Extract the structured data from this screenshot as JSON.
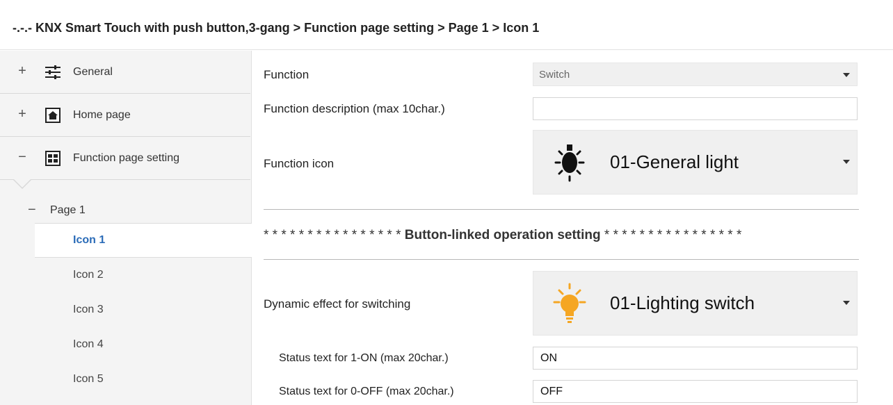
{
  "breadcrumb": "-.-.- KNX Smart Touch with push button,3-gang > Function page setting > Page 1 > Icon 1",
  "sidebar": {
    "items": [
      {
        "label": "General",
        "expander": "+",
        "icon": "sliders-icon"
      },
      {
        "label": "Home page",
        "expander": "+",
        "icon": "home-icon"
      },
      {
        "label": "Function page setting",
        "expander": "−",
        "icon": "grid-icon"
      }
    ],
    "page": {
      "label": "Page 1",
      "expander": "−"
    },
    "icons": [
      "Icon 1",
      "Icon 2",
      "Icon 3",
      "Icon 4",
      "Icon 5"
    ],
    "selected_icon": "Icon 1"
  },
  "params": {
    "function": {
      "label": "Function",
      "value": "Switch"
    },
    "description": {
      "label": "Function description (max 10char.)",
      "value": ""
    },
    "function_icon": {
      "label": "Function icon",
      "value": "01-General light",
      "icon": "light-bulb-icon"
    },
    "separator": {
      "stars_left": "* * * * * * * * * * * * * * * *",
      "title": "Button-linked operation setting",
      "stars_right": "* * * * * * * * * * * * * * * *"
    },
    "dynamic_effect": {
      "label": "Dynamic effect for switching",
      "value": "01-Lighting switch",
      "icon": "lighting-bulb-icon"
    },
    "status_on": {
      "label": "Status text for 1-ON (max 20char.)",
      "value": "ON"
    },
    "status_off": {
      "label": "Status text for 0-OFF (max 20char.)",
      "value": "OFF"
    }
  },
  "colors": {
    "accent": "#2b6cb8",
    "bulb_yellow": "#f5a623",
    "sidebar_bg": "#f4f4f4"
  }
}
